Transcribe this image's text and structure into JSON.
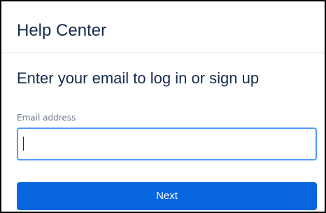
{
  "header": {
    "title": "Help Center"
  },
  "form": {
    "heading": "Enter your email to log in or sign up",
    "email_label": "Email address",
    "email_value": "",
    "email_placeholder": "",
    "submit_label": "Next"
  },
  "colors": {
    "primary_button": "#0765e0",
    "input_focus_border": "#4c9aff",
    "heading_text": "#172b4d",
    "label_text": "#6b778c"
  }
}
